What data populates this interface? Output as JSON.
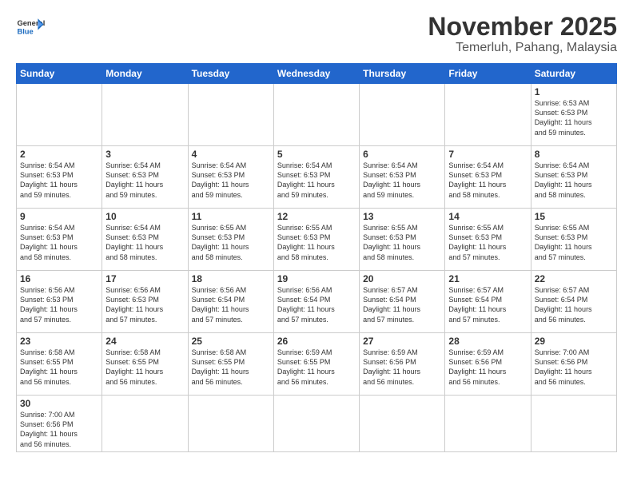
{
  "header": {
    "logo_general": "General",
    "logo_blue": "Blue",
    "month": "November 2025",
    "location": "Temerluh, Pahang, Malaysia"
  },
  "weekdays": [
    "Sunday",
    "Monday",
    "Tuesday",
    "Wednesday",
    "Thursday",
    "Friday",
    "Saturday"
  ],
  "weeks": [
    [
      {
        "day": "",
        "info": ""
      },
      {
        "day": "",
        "info": ""
      },
      {
        "day": "",
        "info": ""
      },
      {
        "day": "",
        "info": ""
      },
      {
        "day": "",
        "info": ""
      },
      {
        "day": "",
        "info": ""
      },
      {
        "day": "1",
        "info": "Sunrise: 6:53 AM\nSunset: 6:53 PM\nDaylight: 11 hours\nand 59 minutes."
      }
    ],
    [
      {
        "day": "2",
        "info": "Sunrise: 6:54 AM\nSunset: 6:53 PM\nDaylight: 11 hours\nand 59 minutes."
      },
      {
        "day": "3",
        "info": "Sunrise: 6:54 AM\nSunset: 6:53 PM\nDaylight: 11 hours\nand 59 minutes."
      },
      {
        "day": "4",
        "info": "Sunrise: 6:54 AM\nSunset: 6:53 PM\nDaylight: 11 hours\nand 59 minutes."
      },
      {
        "day": "5",
        "info": "Sunrise: 6:54 AM\nSunset: 6:53 PM\nDaylight: 11 hours\nand 59 minutes."
      },
      {
        "day": "6",
        "info": "Sunrise: 6:54 AM\nSunset: 6:53 PM\nDaylight: 11 hours\nand 59 minutes."
      },
      {
        "day": "7",
        "info": "Sunrise: 6:54 AM\nSunset: 6:53 PM\nDaylight: 11 hours\nand 58 minutes."
      },
      {
        "day": "8",
        "info": "Sunrise: 6:54 AM\nSunset: 6:53 PM\nDaylight: 11 hours\nand 58 minutes."
      }
    ],
    [
      {
        "day": "9",
        "info": "Sunrise: 6:54 AM\nSunset: 6:53 PM\nDaylight: 11 hours\nand 58 minutes."
      },
      {
        "day": "10",
        "info": "Sunrise: 6:54 AM\nSunset: 6:53 PM\nDaylight: 11 hours\nand 58 minutes."
      },
      {
        "day": "11",
        "info": "Sunrise: 6:55 AM\nSunset: 6:53 PM\nDaylight: 11 hours\nand 58 minutes."
      },
      {
        "day": "12",
        "info": "Sunrise: 6:55 AM\nSunset: 6:53 PM\nDaylight: 11 hours\nand 58 minutes."
      },
      {
        "day": "13",
        "info": "Sunrise: 6:55 AM\nSunset: 6:53 PM\nDaylight: 11 hours\nand 58 minutes."
      },
      {
        "day": "14",
        "info": "Sunrise: 6:55 AM\nSunset: 6:53 PM\nDaylight: 11 hours\nand 57 minutes."
      },
      {
        "day": "15",
        "info": "Sunrise: 6:55 AM\nSunset: 6:53 PM\nDaylight: 11 hours\nand 57 minutes."
      }
    ],
    [
      {
        "day": "16",
        "info": "Sunrise: 6:56 AM\nSunset: 6:53 PM\nDaylight: 11 hours\nand 57 minutes."
      },
      {
        "day": "17",
        "info": "Sunrise: 6:56 AM\nSunset: 6:53 PM\nDaylight: 11 hours\nand 57 minutes."
      },
      {
        "day": "18",
        "info": "Sunrise: 6:56 AM\nSunset: 6:54 PM\nDaylight: 11 hours\nand 57 minutes."
      },
      {
        "day": "19",
        "info": "Sunrise: 6:56 AM\nSunset: 6:54 PM\nDaylight: 11 hours\nand 57 minutes."
      },
      {
        "day": "20",
        "info": "Sunrise: 6:57 AM\nSunset: 6:54 PM\nDaylight: 11 hours\nand 57 minutes."
      },
      {
        "day": "21",
        "info": "Sunrise: 6:57 AM\nSunset: 6:54 PM\nDaylight: 11 hours\nand 57 minutes."
      },
      {
        "day": "22",
        "info": "Sunrise: 6:57 AM\nSunset: 6:54 PM\nDaylight: 11 hours\nand 56 minutes."
      }
    ],
    [
      {
        "day": "23",
        "info": "Sunrise: 6:58 AM\nSunset: 6:55 PM\nDaylight: 11 hours\nand 56 minutes."
      },
      {
        "day": "24",
        "info": "Sunrise: 6:58 AM\nSunset: 6:55 PM\nDaylight: 11 hours\nand 56 minutes."
      },
      {
        "day": "25",
        "info": "Sunrise: 6:58 AM\nSunset: 6:55 PM\nDaylight: 11 hours\nand 56 minutes."
      },
      {
        "day": "26",
        "info": "Sunrise: 6:59 AM\nSunset: 6:55 PM\nDaylight: 11 hours\nand 56 minutes."
      },
      {
        "day": "27",
        "info": "Sunrise: 6:59 AM\nSunset: 6:56 PM\nDaylight: 11 hours\nand 56 minutes."
      },
      {
        "day": "28",
        "info": "Sunrise: 6:59 AM\nSunset: 6:56 PM\nDaylight: 11 hours\nand 56 minutes."
      },
      {
        "day": "29",
        "info": "Sunrise: 7:00 AM\nSunset: 6:56 PM\nDaylight: 11 hours\nand 56 minutes."
      }
    ],
    [
      {
        "day": "30",
        "info": "Sunrise: 7:00 AM\nSunset: 6:56 PM\nDaylight: 11 hours\nand 56 minutes."
      },
      {
        "day": "",
        "info": ""
      },
      {
        "day": "",
        "info": ""
      },
      {
        "day": "",
        "info": ""
      },
      {
        "day": "",
        "info": ""
      },
      {
        "day": "",
        "info": ""
      },
      {
        "day": "",
        "info": ""
      }
    ]
  ]
}
